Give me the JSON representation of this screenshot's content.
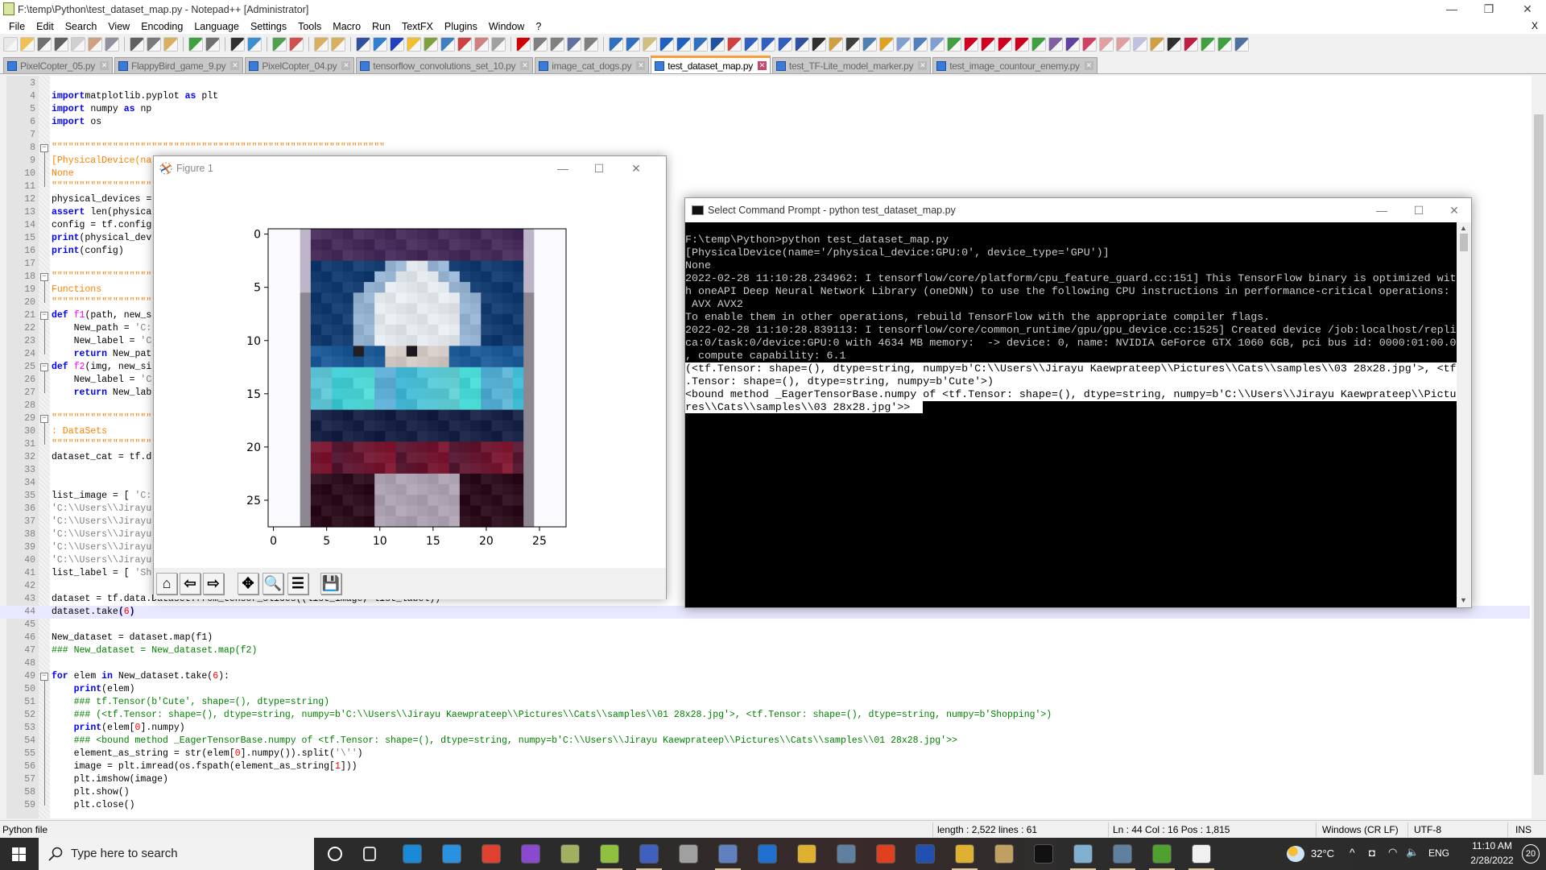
{
  "window": {
    "title": "F:\\temp\\Python\\test_dataset_map.py - Notepad++ [Administrator]",
    "minimize": "—",
    "restore": "❐",
    "close": "✕",
    "doc_close": "X"
  },
  "menu": [
    "File",
    "Edit",
    "Search",
    "View",
    "Encoding",
    "Language",
    "Settings",
    "Tools",
    "Macro",
    "Run",
    "TextFX",
    "Plugins",
    "Window",
    "?"
  ],
  "toolbar": {
    "icons": [
      [
        "new-file",
        "#e8e8e8"
      ],
      [
        "open-file",
        "#f0c050"
      ],
      [
        "save",
        "#707070"
      ],
      [
        "save-all",
        "#606060"
      ],
      [
        "close",
        "#d0d0d0"
      ],
      [
        "close-all",
        "#d0a080"
      ],
      [
        "print",
        "#9090a0"
      ],
      "|",
      [
        "cut",
        "#606060"
      ],
      [
        "copy",
        "#7a7a7a"
      ],
      [
        "paste",
        "#d8b060"
      ],
      "|",
      [
        "undo",
        "#40a040"
      ],
      [
        "redo",
        "#707070"
      ],
      "|",
      [
        "find",
        "#303030"
      ],
      [
        "replace",
        "#3a90d0"
      ],
      "|",
      [
        "zoom-in",
        "#50a050"
      ],
      [
        "zoom-out",
        "#d05050"
      ],
      "|",
      [
        "sync-vertical",
        "#d8b060"
      ],
      [
        "sync-horizontal",
        "#d8b060"
      ],
      "|",
      [
        "word-wrap",
        "#3050a0"
      ],
      [
        "show-all-characters",
        "#3080d0"
      ],
      [
        "indent-guide",
        "#2040c0"
      ],
      [
        "user-defined-language",
        "#f0c030"
      ],
      [
        "document-map",
        "#80a040"
      ],
      [
        "function-list",
        "#4080c0"
      ],
      [
        "folder-as-workspace",
        "#d04040"
      ],
      [
        "document-list",
        "#d08080"
      ],
      [
        "monitoring",
        "#a0a0a0"
      ],
      "|",
      [
        "record-macro",
        "#d00000"
      ],
      [
        "stop-recording",
        "#808080"
      ],
      [
        "playback-macro",
        "#808080"
      ],
      [
        "run-macro-multiple",
        "#6070a0"
      ],
      [
        "save-macro",
        "#808080"
      ],
      "|",
      [
        "plugin-up",
        "#3070c0"
      ],
      [
        "plugin-back",
        "#3070c0"
      ],
      [
        "plugin-page",
        "#d0c080"
      ],
      [
        "plugin-forward",
        "#2060c0"
      ],
      [
        "plugin-down",
        "#2060c0"
      ],
      [
        "plugin-insert",
        "#3070c0"
      ],
      [
        "plugin-list",
        "#2050a0"
      ],
      [
        "plugin-tree",
        "#d04040"
      ],
      [
        "plugin-collapse",
        "#3060c0"
      ],
      [
        "plugin-expand",
        "#3060c0"
      ],
      [
        "plugin-indent",
        "#3060c0"
      ],
      [
        "plugin-grid",
        "#3050a0"
      ],
      [
        "plugin-sort",
        "#303030"
      ],
      [
        "plugin-note",
        "#d0a040"
      ],
      [
        "plugin-link",
        "#404040"
      ],
      [
        "plugin-bar",
        "#5080b0"
      ],
      [
        "plugin-globe",
        "#e0a020"
      ],
      [
        "plugin-tag",
        "#80a0d0"
      ],
      [
        "plugin-chain",
        "#5080c0"
      ],
      [
        "plugin-refresh",
        "#80a0d0"
      ],
      [
        "plugin-check",
        "#40a040"
      ],
      [
        "plugin-first",
        "#d00020"
      ],
      [
        "plugin-prev",
        "#d00020"
      ],
      [
        "plugin-next",
        "#d00020"
      ],
      [
        "plugin-last",
        "#d00020"
      ],
      [
        "plugin-step",
        "#40a040"
      ],
      [
        "plugin-step-into",
        "#8060a0"
      ],
      [
        "plugin-step-out",
        "#6040a0"
      ],
      [
        "plugin-tool",
        "#d04060"
      ],
      [
        "plugin-doc",
        "#e0a0a0"
      ],
      [
        "plugin-doc-2",
        "#e0a0a0"
      ],
      [
        "plugin-doc-3",
        "#c0c0e0"
      ],
      [
        "plugin-edit",
        "#d0a040"
      ],
      [
        "plugin-compare",
        "#303030"
      ],
      [
        "plugin-x",
        "#c02040"
      ],
      [
        "plugin-merge",
        "#40a040"
      ],
      [
        "plugin-clean",
        "#40a040"
      ],
      [
        "plugin-settings",
        "#5070a0"
      ]
    ]
  },
  "tabs": [
    {
      "label": "PixelCopter_05.py"
    },
    {
      "label": "FlappyBird_game_9.py"
    },
    {
      "label": "PixelCopter_04.py"
    },
    {
      "label": "tensorflow_convolutions_set_10.py"
    },
    {
      "label": "image_cat_dogs.py"
    },
    {
      "label": "test_dataset_map.py",
      "active": true
    },
    {
      "label": "test_TF-Lite_model_marker.py"
    },
    {
      "label": "test_image_countour_enemy.py"
    }
  ],
  "editor": {
    "current_line": 44,
    "fold_lines": [
      8,
      18,
      21,
      25,
      29,
      49
    ],
    "lines": [
      {
        "n": "3",
        "t": []
      },
      {
        "n": "4",
        "t": [
          [
            "kw",
            "import"
          ],
          [
            "",
            "matplotlib.pyplot "
          ],
          [
            "kw",
            "as"
          ],
          [
            "",
            " plt"
          ]
        ]
      },
      {
        "n": "5",
        "t": [
          [
            "kw",
            "import"
          ],
          [
            "",
            " numpy "
          ],
          [
            "kw",
            "as"
          ],
          [
            "",
            " np"
          ]
        ]
      },
      {
        "n": "6",
        "t": [
          [
            "kw",
            "import"
          ],
          [
            "",
            " os"
          ]
        ]
      },
      {
        "n": "7",
        "t": []
      },
      {
        "n": "8",
        "t": [
          [
            "tq",
            "\"\"\"\"\"\"\"\"\"\"\"\"\"\"\"\"\"\"\"\"\"\"\"\"\"\"\"\"\"\"\"\"\"\"\"\"\"\"\"\"\"\"\"\"\"\"\"\"\"\"\"\"\"\"\"\"\"\"\"\""
          ]
        ]
      },
      {
        "n": "9",
        "t": [
          [
            "tq",
            "[PhysicalDevice(na"
          ]
        ]
      },
      {
        "n": "10",
        "t": [
          [
            "tq",
            "None"
          ]
        ]
      },
      {
        "n": "11",
        "t": [
          [
            "tq",
            "\"\"\"\"\"\"\"\"\"\"\"\"\"\"\"\"\"\"\"\""
          ]
        ]
      },
      {
        "n": "12",
        "t": [
          [
            "",
            "physical_devices ="
          ]
        ]
      },
      {
        "n": "13",
        "t": [
          [
            "kw",
            "assert"
          ],
          [
            "",
            " len(physica"
          ]
        ]
      },
      {
        "n": "14",
        "t": [
          [
            "",
            "config = tf.config"
          ]
        ]
      },
      {
        "n": "15",
        "t": [
          [
            "kw",
            "print"
          ],
          [
            "",
            "(physical_dev"
          ]
        ]
      },
      {
        "n": "16",
        "t": [
          [
            "kw",
            "print"
          ],
          [
            "",
            "(config)"
          ]
        ]
      },
      {
        "n": "17",
        "t": []
      },
      {
        "n": "18",
        "t": [
          [
            "tq",
            "\"\"\"\"\"\"\"\"\"\"\"\"\"\"\"\"\"\"\"\""
          ]
        ]
      },
      {
        "n": "19",
        "t": [
          [
            "tq",
            "Functions"
          ]
        ]
      },
      {
        "n": "20",
        "t": [
          [
            "tq",
            "\"\"\"\"\"\"\"\"\"\"\"\"\"\"\"\"\"\"\"\""
          ]
        ]
      },
      {
        "n": "21",
        "t": [
          [
            "kw",
            "def"
          ],
          [
            "",
            " "
          ],
          [
            "fn",
            "f1"
          ],
          [
            "",
            "(path, new_s"
          ]
        ]
      },
      {
        "n": "22",
        "t": [
          [
            "",
            "    New_path = "
          ],
          [
            "st",
            "'C:"
          ]
        ]
      },
      {
        "n": "23",
        "t": [
          [
            "",
            "    New_label = "
          ],
          [
            "st",
            "'C"
          ]
        ]
      },
      {
        "n": "24",
        "t": [
          [
            "",
            "    "
          ],
          [
            "kw",
            "return"
          ],
          [
            "",
            " New_pat"
          ]
        ]
      },
      {
        "n": "25",
        "t": [
          [
            "kw",
            "def"
          ],
          [
            "",
            " "
          ],
          [
            "fn",
            "f2"
          ],
          [
            "",
            "(img, new_si"
          ]
        ]
      },
      {
        "n": "26",
        "t": [
          [
            "",
            "    New_label = "
          ],
          [
            "st",
            "'C"
          ]
        ]
      },
      {
        "n": "27",
        "t": [
          [
            "",
            "    "
          ],
          [
            "kw",
            "return"
          ],
          [
            "",
            " New_lab"
          ]
        ]
      },
      {
        "n": "28",
        "t": []
      },
      {
        "n": "29",
        "t": [
          [
            "tq",
            "\"\"\"\"\"\"\"\"\"\"\"\"\"\"\"\"\"\"\"\""
          ]
        ]
      },
      {
        "n": "30",
        "t": [
          [
            "tq",
            ": DataSets"
          ]
        ]
      },
      {
        "n": "31",
        "t": [
          [
            "tq",
            "\"\"\"\"\"\"\"\"\"\"\"\"\"\"\"\"\"\"\"\""
          ]
        ]
      },
      {
        "n": "32",
        "t": [
          [
            "",
            "dataset_cat = tf.d"
          ]
        ]
      },
      {
        "n": "33",
        "t": []
      },
      {
        "n": "34",
        "t": []
      },
      {
        "n": "35",
        "t": [
          [
            "",
            "list_image = [ "
          ],
          [
            "st",
            "'C:"
          ]
        ]
      },
      {
        "n": "36",
        "t": [
          [
            "st",
            "'C:\\\\Users\\\\Jirayu"
          ]
        ]
      },
      {
        "n": "37",
        "t": [
          [
            "st",
            "'C:\\\\Users\\\\Jirayu"
          ]
        ]
      },
      {
        "n": "38",
        "t": [
          [
            "st",
            "'C:\\\\Users\\\\Jirayu"
          ]
        ]
      },
      {
        "n": "39",
        "t": [
          [
            "st",
            "'C:\\\\Users\\\\Jirayu"
          ]
        ]
      },
      {
        "n": "40",
        "t": [
          [
            "st",
            "'C:\\\\Users\\\\Jirayu"
          ]
        ]
      },
      {
        "n": "41",
        "t": [
          [
            "",
            "list_label = [ "
          ],
          [
            "st",
            "'Sh"
          ]
        ]
      },
      {
        "n": "42",
        "t": []
      },
      {
        "n": "43",
        "t": [
          [
            "",
            "dataset = tf.data.Dataset.from_tensor_slices((list_image, list_label))"
          ]
        ]
      },
      {
        "n": "44",
        "t": [
          [
            "",
            "dataset.take"
          ],
          [
            "op",
            "("
          ],
          [
            "nm",
            "6"
          ],
          [
            "op",
            ")"
          ]
        ]
      },
      {
        "n": "45",
        "t": []
      },
      {
        "n": "46",
        "t": [
          [
            "",
            "New_dataset = dataset.map(f1)"
          ]
        ]
      },
      {
        "n": "47",
        "t": [
          [
            "cm",
            "### New_dataset = New_dataset.map(f2)"
          ]
        ]
      },
      {
        "n": "48",
        "t": []
      },
      {
        "n": "49",
        "t": [
          [
            "kw",
            "for"
          ],
          [
            "",
            " elem "
          ],
          [
            "kw",
            "in"
          ],
          [
            "",
            " New_dataset.take("
          ],
          [
            "nm",
            "6"
          ],
          [
            "",
            "):"
          ]
        ]
      },
      {
        "n": "50",
        "t": [
          [
            "",
            "    "
          ],
          [
            "kw",
            "print"
          ],
          [
            "",
            "(elem)"
          ]
        ]
      },
      {
        "n": "51",
        "t": [
          [
            "cm",
            "    ### tf.Tensor(b'Cute', shape=(), dtype=string)"
          ]
        ]
      },
      {
        "n": "52",
        "t": [
          [
            "cm",
            "    ### (<tf.Tensor: shape=(), dtype=string, numpy=b'C:\\\\Users\\\\Jirayu Kaewprateep\\\\Pictures\\\\Cats\\\\samples\\\\01 28x28.jpg'>, <tf.Tensor: shape=(), dtype=string, numpy=b'Shopping'>)"
          ]
        ]
      },
      {
        "n": "53",
        "t": [
          [
            "",
            "    "
          ],
          [
            "kw",
            "print"
          ],
          [
            "",
            "(elem["
          ],
          [
            "nm",
            "0"
          ],
          [
            "",
            "].numpy)"
          ]
        ]
      },
      {
        "n": "54",
        "t": [
          [
            "cm",
            "    ### <bound method _EagerTensorBase.numpy of <tf.Tensor: shape=(), dtype=string, numpy=b'C:\\\\Users\\\\Jirayu Kaewprateep\\\\Pictures\\\\Cats\\\\samples\\\\01 28x28.jpg'>>"
          ]
        ]
      },
      {
        "n": "55",
        "t": [
          [
            "",
            "    element_as_string = str(elem["
          ],
          [
            "nm",
            "0"
          ],
          [
            "",
            "].numpy()).split("
          ],
          [
            "st",
            "'\\''"
          ],
          [
            "",
            ")"
          ]
        ]
      },
      {
        "n": "56",
        "t": [
          [
            "",
            "    image = plt.imread(os.fspath(element_as_string["
          ],
          [
            "nm",
            "1"
          ],
          [
            "",
            "]))"
          ]
        ]
      },
      {
        "n": "57",
        "t": [
          [
            "",
            "    plt.imshow(image)"
          ]
        ]
      },
      {
        "n": "58",
        "t": [
          [
            "",
            "    plt.show()"
          ]
        ]
      },
      {
        "n": "59",
        "t": [
          [
            "",
            "    plt.close()"
          ]
        ]
      }
    ]
  },
  "status": {
    "file_type": "Python file",
    "length": "length : 2,522    lines : 61",
    "position": "Ln : 44    Col : 16    Pos : 1,815",
    "eol": "Windows (CR LF)",
    "encoding": "UTF-8",
    "mode": "INS"
  },
  "figure": {
    "title": "Figure 1",
    "xticks": [
      "0",
      "5",
      "10",
      "15",
      "20",
      "25"
    ],
    "yticks": [
      "0",
      "5",
      "10",
      "15",
      "20",
      "25"
    ],
    "image_size": "28x28",
    "tools": [
      "home",
      "back",
      "forward",
      "pan",
      "zoom",
      "configure-subplots",
      "save"
    ]
  },
  "cmd": {
    "title": "Select Command Prompt - python  test_dataset_map.py",
    "lines": [
      "F:\\temp\\Python>python test_dataset_map.py",
      "[PhysicalDevice(name='/physical_device:GPU:0', device_type='GPU')]",
      "None",
      "2022-02-28 11:10:28.234962: I tensorflow/core/platform/cpu_feature_guard.cc:151] This TensorFlow binary is optimized wit",
      "h oneAPI Deep Neural Network Library (oneDNN) to use the following CPU instructions in performance-critical operations:",
      " AVX AVX2",
      "To enable them in other operations, rebuild TensorFlow with the appropriate compiler flags.",
      "2022-02-28 11:10:28.839113: I tensorflow/core/common_runtime/gpu/gpu_device.cc:1525] Created device /job:localhost/repli",
      "ca:0/task:0/device:GPU:0 with 4634 MB memory:  -> device: 0, name: NVIDIA GeForce GTX 1060 6GB, pci bus id: 0000:01:00.0",
      ", compute capability: 6.1",
      "(<tf.Tensor: shape=(), dtype=string, numpy=b'C:\\\\Users\\\\Jirayu Kaewprateep\\\\Pictures\\\\Cats\\\\samples\\\\03 28x28.jpg'>, <tf",
      ".Tensor: shape=(), dtype=string, numpy=b'Cute'>)",
      "<bound method _EagerTensorBase.numpy of <tf.Tensor: shape=(), dtype=string, numpy=b'C:\\\\Users\\\\Jirayu Kaewprateep\\\\Pictu",
      "res\\\\Cats\\\\samples\\\\03 28x28.jpg'>>  "
    ],
    "selected_from": 10
  },
  "taskbar": {
    "search_placeholder": "Type here to search",
    "apps": [
      [
        "cortana",
        "#2b2b2b"
      ],
      [
        "task-view",
        "#2b2b2b"
      ],
      [
        "edge",
        "#1a8ad8"
      ],
      [
        "mail",
        "#2a90e0"
      ],
      [
        "chrome",
        "#e04030"
      ],
      [
        "visual-studio",
        "#8a4ad0"
      ],
      [
        "app-tool",
        "#a0b060"
      ],
      [
        "notepad-plus-plus",
        "#90c040"
      ],
      [
        "network-app",
        "#4060c0"
      ],
      [
        "monitor-app",
        "#a0a0a0"
      ],
      [
        "remote-app",
        "#6080c0"
      ],
      [
        "blue-app",
        "#2070d0"
      ],
      [
        "folder-app",
        "#e0b030"
      ],
      [
        "virtualbox",
        "#6080a0"
      ],
      [
        "orange-app",
        "#e04020"
      ],
      [
        "powershell",
        "#2050b0"
      ],
      [
        "file-explorer",
        "#e0b030"
      ],
      [
        "paint",
        "#c0a060"
      ],
      [
        "command-prompt",
        "#111111"
      ],
      [
        "notepad",
        "#80b0d0"
      ],
      [
        "calculator",
        "#6080a0"
      ],
      [
        "nvidia",
        "#50a030"
      ],
      [
        "figure-app",
        "#f0f0f0"
      ]
    ],
    "weather": "32°C",
    "language": "ENG",
    "time": "11:10 AM",
    "date": "2/28/2022",
    "notifications": "20"
  }
}
